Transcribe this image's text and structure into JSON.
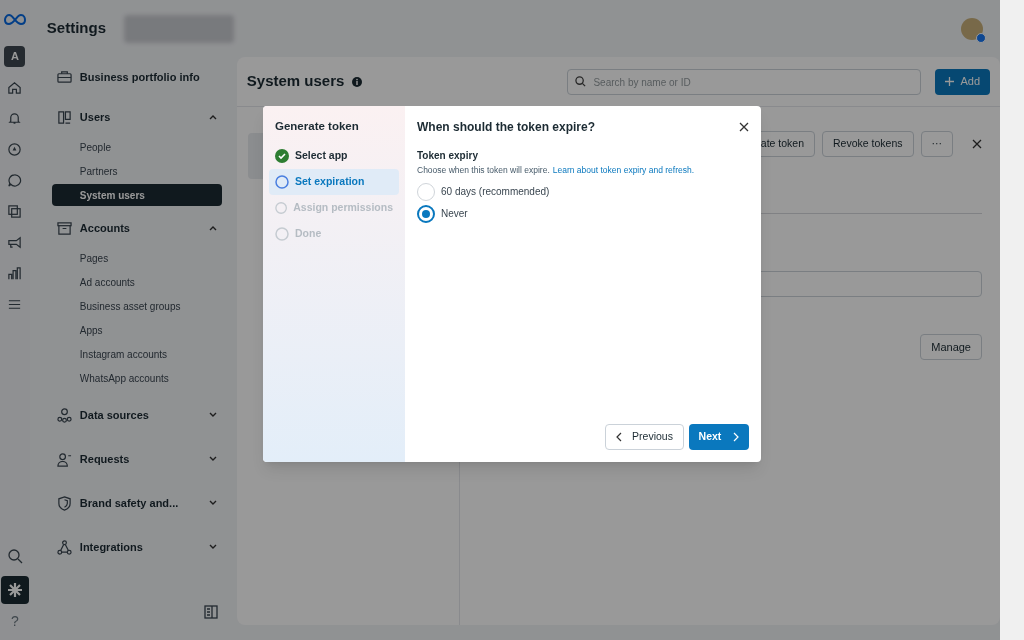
{
  "rail": {
    "account_letter": "A",
    "help": "?",
    "items": [
      {
        "selected": false
      },
      {
        "selected": false
      },
      {
        "selected": false
      },
      {
        "selected": false
      },
      {
        "selected": false
      },
      {
        "selected": false
      },
      {
        "selected": false
      },
      {
        "selected": false
      }
    ],
    "bottom": [
      {
        "selected": false
      },
      {
        "selected": true
      }
    ]
  },
  "header": {
    "title": "Settings"
  },
  "sidebar": {
    "items": [
      {
        "kind": "link",
        "label": "Business portfolio info"
      },
      {
        "kind": "group",
        "label": "Users",
        "expanded": true,
        "children": [
          {
            "label": "People",
            "selected": false
          },
          {
            "label": "Partners",
            "selected": false
          },
          {
            "label": "System users",
            "selected": true
          }
        ]
      },
      {
        "kind": "group",
        "label": "Accounts",
        "expanded": true,
        "children": [
          {
            "label": "Pages",
            "selected": false
          },
          {
            "label": "Ad accounts",
            "selected": false
          },
          {
            "label": "Business asset groups",
            "selected": false
          },
          {
            "label": "Apps",
            "selected": false
          },
          {
            "label": "Instagram accounts",
            "selected": false
          },
          {
            "label": "WhatsApp accounts",
            "selected": false
          }
        ]
      },
      {
        "kind": "group",
        "label": "Data sources",
        "expanded": false
      },
      {
        "kind": "group",
        "label": "Requests",
        "expanded": false
      },
      {
        "kind": "group",
        "label": "Brand safety and...",
        "expanded": false
      },
      {
        "kind": "group",
        "label": "Integrations",
        "expanded": false
      }
    ]
  },
  "main": {
    "title": "System users",
    "search": {
      "placeholder": "Search by name or ID"
    },
    "add_button": "Add",
    "detail_buttons": [
      "ate token",
      "Revoke tokens",
      "···"
    ],
    "manage_button": "Manage"
  },
  "modal": {
    "title": "Generate token",
    "steps": [
      {
        "label": "Select app",
        "completed": true,
        "selected": false,
        "disabled": false
      },
      {
        "label": "Set expiration",
        "completed": false,
        "selected": true,
        "disabled": false
      },
      {
        "label": "Assign permissions",
        "completed": false,
        "selected": false,
        "disabled": true
      },
      {
        "label": "Done",
        "completed": false,
        "selected": false,
        "disabled": true
      }
    ],
    "heading": "When should the token expire?",
    "section_title": "Token expiry",
    "description": "Choose when this token will expire.",
    "link": "Learn about token expiry and refresh.",
    "options": [
      {
        "label": "60 days (recommended)",
        "selected": false
      },
      {
        "label": "Never",
        "selected": true
      }
    ],
    "previous": "Previous",
    "next": "Next"
  }
}
